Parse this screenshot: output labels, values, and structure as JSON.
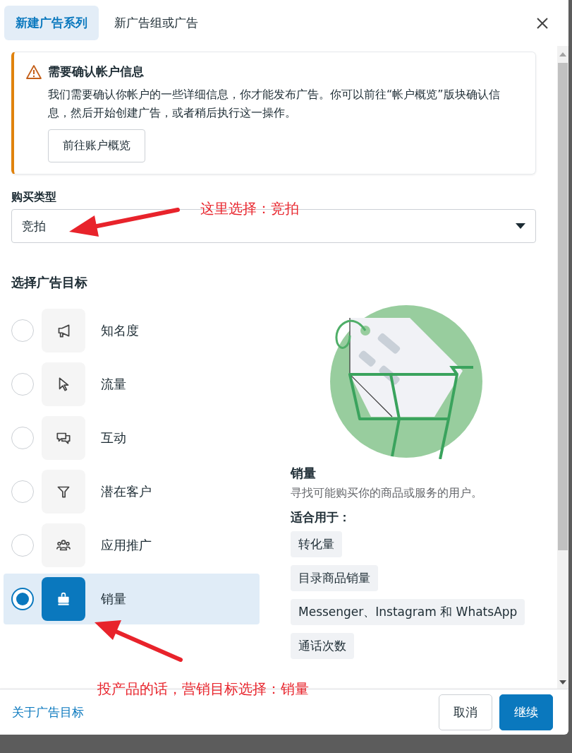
{
  "tabs": [
    {
      "label": "新建广告系列",
      "selected": true
    },
    {
      "label": "新广告组或广告",
      "selected": false
    }
  ],
  "alert": {
    "title": "需要确认帐户信息",
    "body": "我们需要确认你帐户的一些详细信息，你才能发布广告。你可以前往“帐户概览”版块确认信息，然后开始创建广告，或者稍后执行这一操作。",
    "button": "前往账户概览"
  },
  "buy_type": {
    "label": "购买类型",
    "value": "竞拍"
  },
  "objective_heading": "选择广告目标",
  "objectives": [
    {
      "label": "知名度",
      "kind": "megaphone",
      "selected": false
    },
    {
      "label": "流量",
      "kind": "cursor",
      "selected": false
    },
    {
      "label": "互动",
      "kind": "chat",
      "selected": false
    },
    {
      "label": "潜在客户",
      "kind": "funnel",
      "selected": false
    },
    {
      "label": "应用推广",
      "kind": "people",
      "selected": false
    },
    {
      "label": "销量",
      "kind": "bag",
      "selected": true
    }
  ],
  "detail": {
    "title": "销量",
    "description": "寻找可能购买你的商品或服务的用户。",
    "suited_label": "适合用于：",
    "tags": [
      "转化量",
      "目录商品销量",
      "Messenger、Instagram 和 WhatsApp",
      "通话次数"
    ]
  },
  "footer": {
    "link": "关于广告目标",
    "buttons": [
      {
        "label": "取消",
        "kind": "secondary"
      },
      {
        "label": "继续",
        "kind": "primary"
      }
    ]
  },
  "annotations": [
    "这里选择：竞拍",
    "投产品的话，营销目标选择：销量"
  ]
}
